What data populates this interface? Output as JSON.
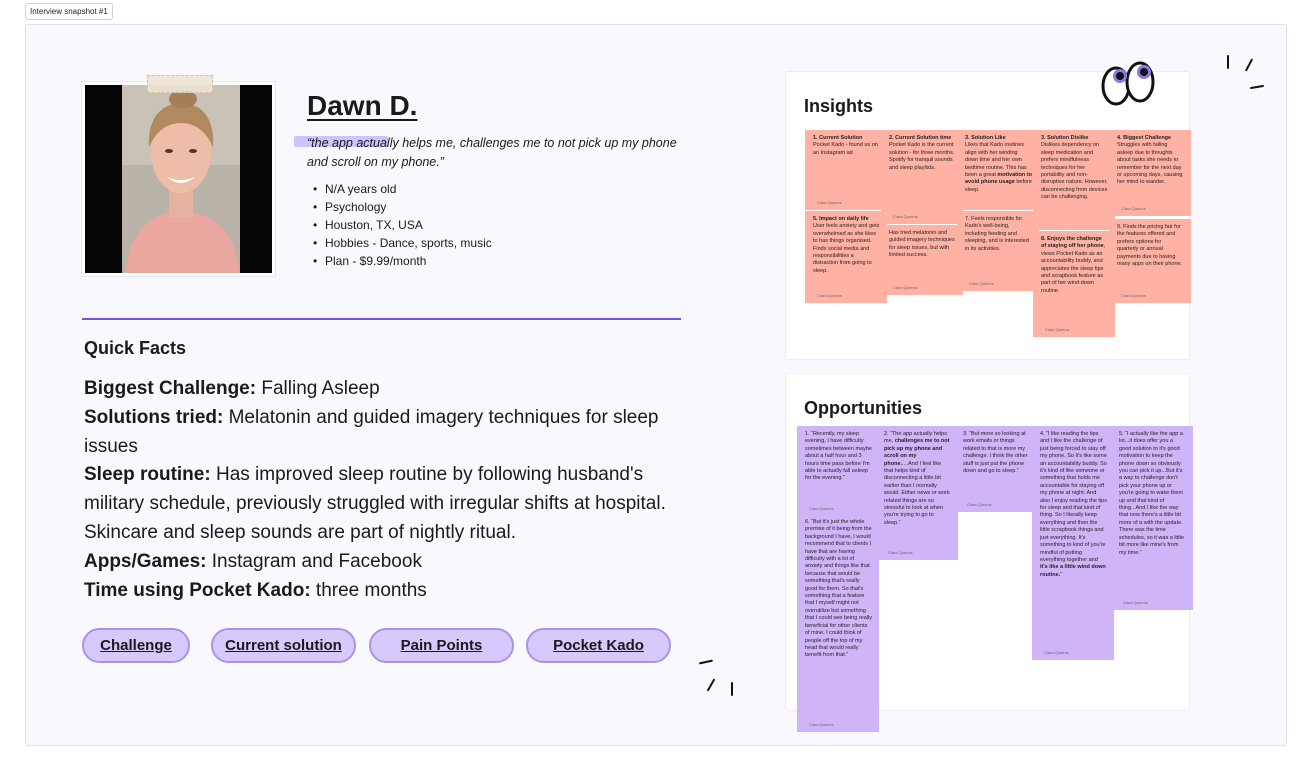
{
  "frame_label": "Interview snapshot #1",
  "profile": {
    "name": "Dawn D.",
    "quote": "“the app actually helps me, challenges me to not pick up my phone and scroll on my phone.”",
    "facts": [
      "N/A years old",
      "Psychology",
      "Houston, TX, USA",
      "Hobbies - Dance, sports, music",
      "Plan - $9.99/month"
    ]
  },
  "quick_facts": {
    "title": "Quick Facts",
    "rows": [
      {
        "label": "Biggest Challenge:",
        "value": " Falling Asleep"
      },
      {
        "label": "Solutions tried:",
        "value": " Melatonin and guided imagery techniques for sleep issues"
      },
      {
        "label": "Sleep routine:",
        "value": " Has improved sleep routine by following husband's military schedule, previously struggled with irregular shifts at hospital. Skincare and sleep sounds are part of nightly ritual."
      },
      {
        "label": "Apps/Games:",
        "value": " Instagram and Facebook"
      },
      {
        "label": "Time using Pocket Kado:",
        "value": " three months"
      }
    ]
  },
  "buttons": [
    "Challenge",
    "Current solution",
    "Pain Points",
    "Pocket Kado"
  ],
  "insights": {
    "title": "Insights",
    "author": "Clara Queirós",
    "notes": [
      {
        "html": "<b>1. Current Solution</b><br>Pocket Kado - found us on an Instagram ad"
      },
      {
        "html": "<b>2. Current Solution time</b><br>Pocket Kado is the current solution - for three months.<br>Spotify for tranquil sounds and sleep playlists."
      },
      {
        "html": "<b>3. Solution Like</b><br>Likes that Kado routines align with her winding down time and her own bedtime routine. This has been a great <b>motivation to avoid phone usage</b> before sleep."
      },
      {
        "html": "<b>3. Solution Dislike</b><br>Dislikes dependency on sleep medication and prefers mindfulness techniques for her portability and non-disruptive nature. However, disconnecting from devices can be challenging."
      },
      {
        "html": "<b>4. Biggest Challenge</b><br>Struggles with falling asleep due to thoughts about tasks she needs to remember for the next day or upcoming days, causing her mind to wander."
      },
      {
        "html": "<b>5. Impact on daily life</b><br>User feels anxiety and gets overwhelmed as she likes to has things organised. Finds social media and responsibilities a distraction from going to sleep."
      },
      {
        "html": "Has tried melatonin and guided imagery techniques for sleep issues, but with limited success."
      },
      {
        "html": "7. Feels responsible for Kado's well-being, including feeding and sleeping, and is interested in its activities."
      },
      {
        "html": "<b>8. Enjoys the challenge of staying off her phone</b>, views Pocket Kado as an accountability buddy, and appreciates the sleep tips and scrapbook feature as part of her wind-down routine."
      },
      {
        "html": "9. Finds the pricing fair for the features offered and prefers options for quarterly or annual payments due to having many apps on their phone."
      }
    ]
  },
  "opportunities": {
    "title": "Opportunities",
    "author": "Clara Queirós",
    "notes": [
      {
        "html": "1. “Recently, my sleep evening, I have difficulty sometimes between maybe about a half hour and 3 hours time pass before I'm able to actually fall asleep for the evening.”"
      },
      {
        "html": "2. “The app actually helps me, <b>challenges me to not pick up my phone and scroll on my phone</b>.....And I feel like that helps kind of disconnecting a little bit earlier than I normally would. Either news or work related things are so stressful to look at when you're trying to go to sleep.”"
      },
      {
        "html": "3. “But more so looking at work emails or things related to that is more my challenge. I think the other stuff is just put the phone down and go to sleep.”"
      },
      {
        "html": "4. “I like reading the tips and I like the challenge of just being forced to stay off my phone. So it's like some an accountability buddy. So it's kind of like someone or something that holds me accountable for staying off my phone at night. And also I enjoy reading the tips for sleep and that kind of thing. So I literally keep everything and then the little scrapbook things and just everything. It's something to kind of you're mindful of putting everything together and <b>it's like a little wind down routine.</b>”"
      },
      {
        "html": "5. “I actually like the app a lot...it does offer you a good solution to it's good motivation to keep the phone down so obviously you can pick it up...But it's a way to challenge don't pick your phone up or you're going to wake them up and that kind of thing...And I like the way that now there's a little bit more of a with the update. There was the time schedules, so it was a little bit more like mine's from my time.”"
      },
      {
        "html": "6. “But it's just the whole premise of it being from the background I have, I would recommend that to clients I have that are having difficulty with a lot of anxiety and things like that because that would be something that's really good for them. So that's something that a feature that I myself might not overutilize but something that I could see being really beneficial for other clients of mine. I could think of people off the top of my head that would really benefit from that.”"
      }
    ]
  }
}
